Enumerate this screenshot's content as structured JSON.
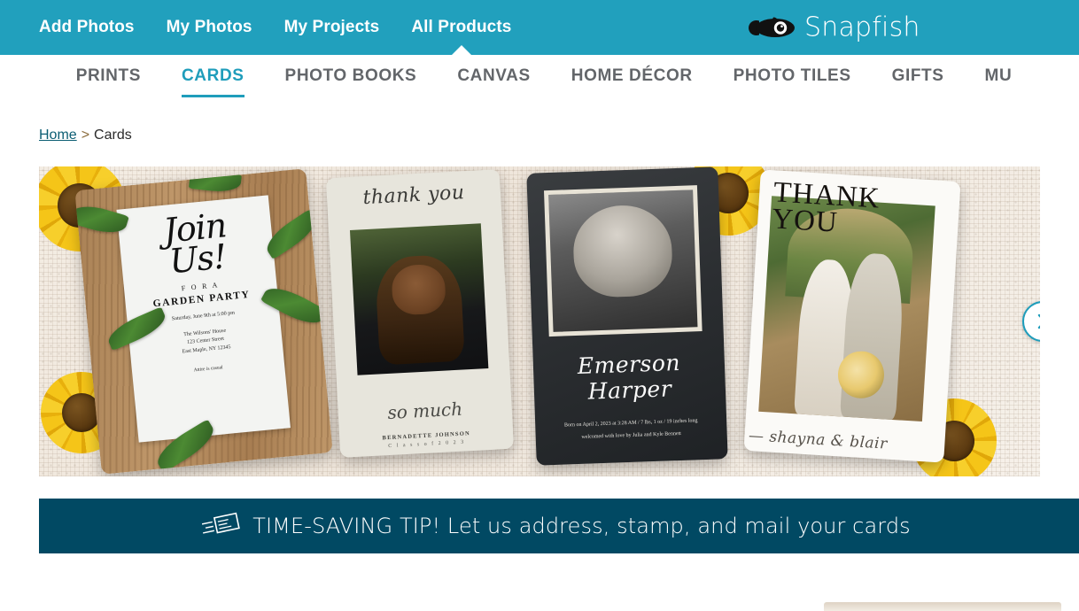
{
  "topbar": {
    "background": "#21A0BD",
    "items": [
      {
        "label": "Add Photos",
        "name": "add-photos",
        "active": false
      },
      {
        "label": "My Photos",
        "name": "my-photos",
        "active": false
      },
      {
        "label": "My Projects",
        "name": "my-projects",
        "active": false
      },
      {
        "label": "All Products",
        "name": "all-products",
        "active": true
      }
    ],
    "logo_text": "Snapfish",
    "logo_icon": "fish-logo-icon"
  },
  "category_nav": {
    "accent_color": "#1F9DBB",
    "inactive_color": "#63666A",
    "items": [
      {
        "label": "PRINTS",
        "active": false
      },
      {
        "label": "CARDS",
        "active": true
      },
      {
        "label": "PHOTO BOOKS",
        "active": false
      },
      {
        "label": "CANVAS",
        "active": false
      },
      {
        "label": "HOME DÉCOR",
        "active": false
      },
      {
        "label": "PHOTO TILES",
        "active": false
      },
      {
        "label": "GIFTS",
        "active": false
      },
      {
        "label": "MU",
        "active": false
      }
    ]
  },
  "breadcrumb": {
    "home": "Home",
    "separator": ">",
    "current": "Cards"
  },
  "hero": {
    "next_arrow_icon": "chevron-right-icon",
    "cards": [
      {
        "id": "garden-party-invitation",
        "script_line1": "Join",
        "script_line2": "Us!",
        "for_a": "F O R   A",
        "occasion": "GARDEN PARTY",
        "detail_date": "Saturday, June 9th at 5:00 pm",
        "detail_venue": "The Wilsons' House",
        "detail_street": "123 Center Street",
        "detail_city": "East Maple, NY 12345",
        "attire": "Attire is casual"
      },
      {
        "id": "graduation-thank-you",
        "top_script": "thank you",
        "bottom_script": "so much",
        "name": "BERNADETTE JOHNSON",
        "class_of": "C l a s s   o f   2 0 2 3"
      },
      {
        "id": "birth-announcement",
        "name": "Emerson Harper",
        "detail_line1": "Born on April 2, 2023 at 3:28 AM / 7 lbs, 1 oz / 19 inches long",
        "detail_line2": "welcomed with love by Julia and Kyle Bennett"
      },
      {
        "id": "wedding-thank-you",
        "thank": "THANK",
        "you": "YOU",
        "signature": "— shayna & blair"
      }
    ]
  },
  "tip_banner": {
    "background": "#014963",
    "icon": "envelope-mail-icon",
    "text": "TIME-SAVING TIP! Let us address, stamp, and mail your cards"
  }
}
